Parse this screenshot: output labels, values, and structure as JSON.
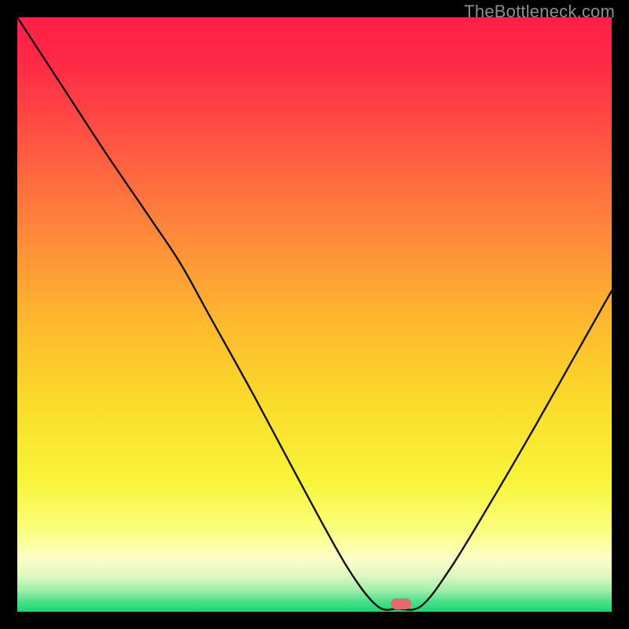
{
  "watermark": "TheBottleneck.com",
  "marker": {
    "x_frac": 0.645,
    "y_frac": 0.987
  },
  "chart_data": {
    "type": "line",
    "title": "",
    "xlabel": "",
    "ylabel": "",
    "xlim": [
      0,
      1
    ],
    "ylim": [
      0,
      1
    ],
    "gradient_note": "Background vertical gradient red→orange→yellow→pale-yellow→green; curve is a V-shape with minimum near x≈0.64",
    "series": [
      {
        "name": "bottleneck-curve",
        "points": [
          {
            "x": 0.0,
            "y": 1.0
          },
          {
            "x": 0.075,
            "y": 0.885
          },
          {
            "x": 0.15,
            "y": 0.77
          },
          {
            "x": 0.225,
            "y": 0.66
          },
          {
            "x": 0.275,
            "y": 0.585
          },
          {
            "x": 0.325,
            "y": 0.495
          },
          {
            "x": 0.4,
            "y": 0.36
          },
          {
            "x": 0.48,
            "y": 0.21
          },
          {
            "x": 0.555,
            "y": 0.075
          },
          {
            "x": 0.605,
            "y": 0.01
          },
          {
            "x": 0.64,
            "y": 0.005
          },
          {
            "x": 0.68,
            "y": 0.01
          },
          {
            "x": 0.73,
            "y": 0.075
          },
          {
            "x": 0.8,
            "y": 0.19
          },
          {
            "x": 0.87,
            "y": 0.31
          },
          {
            "x": 0.935,
            "y": 0.425
          },
          {
            "x": 1.0,
            "y": 0.54
          }
        ]
      }
    ],
    "marker_point": {
      "x": 0.645,
      "y": 0.005
    }
  }
}
